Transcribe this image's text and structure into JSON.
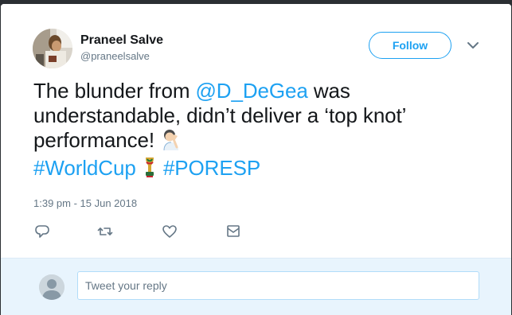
{
  "tweet": {
    "author_name": "Praneel Salve",
    "author_handle": "@praneelsalve",
    "follow_label": "Follow",
    "text_line1_pre": "The blunder from ",
    "text_mention": "@D_DeGea",
    "text_line1_post": " was",
    "text_line2": "understandable, didn’t deliver a ‘top knot’",
    "text_line3": "performance! ",
    "hashtag1": "#WorldCup",
    "hashtag2": "#PORESP",
    "timestamp": "1:39 pm - 15 Jun 2018"
  },
  "icons": {
    "reply": "reply-icon",
    "retweet": "retweet-icon",
    "like": "heart-icon",
    "dm": "envelope-icon",
    "more": "chevron-down-icon",
    "facepalm": "facepalm-emoji",
    "worldcup": "worldcup-trophy-emoji"
  },
  "reply": {
    "placeholder": "Tweet your reply"
  },
  "colors": {
    "accent": "#1da1f2",
    "text": "#14171a",
    "muted": "#657786",
    "reply_bar": "#e8f4fd"
  }
}
